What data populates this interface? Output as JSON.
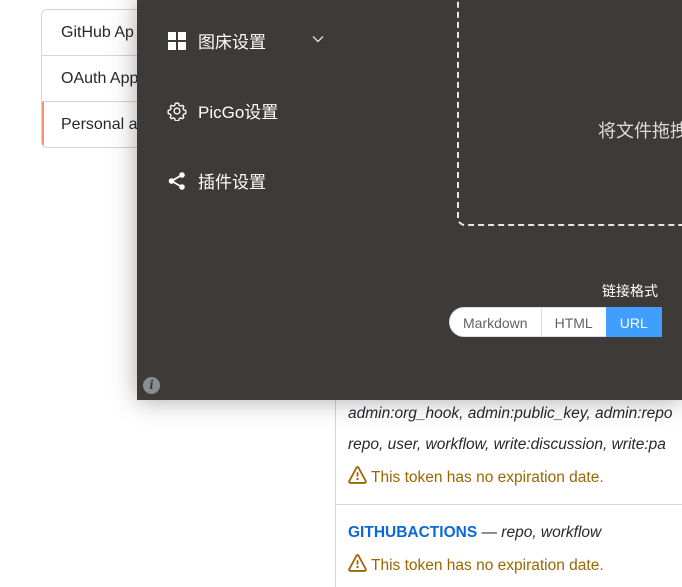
{
  "github": {
    "nav": [
      {
        "label": "GitHub Ap",
        "active": false
      },
      {
        "label": "OAuth App",
        "active": false
      },
      {
        "label": "Personal a",
        "active": true
      }
    ],
    "token1": {
      "scopes_line1": "admin:org_hook, admin:public_key, admin:repo",
      "scopes_line2": "repo, user, workflow, write:discussion, write:pa",
      "warning": "This token has no expiration date."
    },
    "token2": {
      "name": "GITHUBACTIONS",
      "dash": " — ",
      "scopes": "repo, workflow",
      "warning": "This token has no expiration date."
    }
  },
  "picgo": {
    "menu": [
      {
        "label": "图床设置",
        "icon": "grid-icon"
      },
      {
        "label": "PicGo设置",
        "icon": "gear-icon"
      },
      {
        "label": "插件设置",
        "icon": "share-icon"
      }
    ],
    "drop_text": "将文件拖拽",
    "link_format_label": "链接格式",
    "formats": [
      "Markdown",
      "HTML",
      "URL"
    ],
    "selected_format": "URL",
    "info_glyph": "i"
  },
  "colors": {
    "picgo_bg": "#3e3a37",
    "accent_blue": "#409eff",
    "github_link": "#0969da",
    "warning": "#9a6700",
    "nav_active_bar": "#fd8c73"
  }
}
